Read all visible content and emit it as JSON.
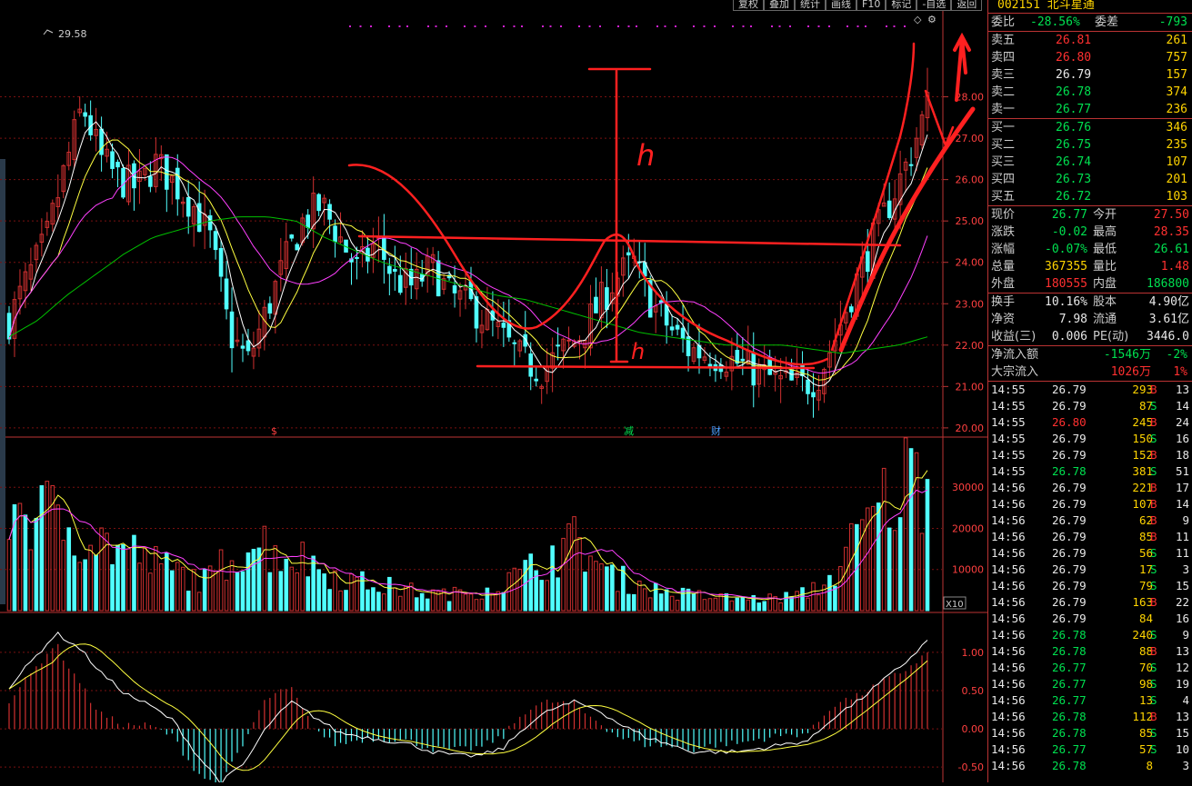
{
  "stock": {
    "code": "002151",
    "name": "北斗星通"
  },
  "toolbar": [
    "复权",
    "叠加",
    "统计",
    "画线",
    "F10",
    "标记",
    "-自选",
    "返回"
  ],
  "colors": {
    "up": "#ff3030",
    "down": "#00e050",
    "flat": "#e8e8e8",
    "vol": "#ffd400",
    "upBar": "#d03030",
    "downBar": "#50ffff",
    "ma5": "#ffffff",
    "ma10": "#ffff40",
    "ma20": "#ff40ff",
    "ma60": "#00c000",
    "annot": "#ff2020",
    "grid": "#7a1010"
  },
  "price_axis_labels": [
    "28.00",
    "27.00",
    "26.00",
    "25.00",
    "24.00",
    "23.00",
    "22.00",
    "21.00",
    "20.00"
  ],
  "vol_axis_labels": [
    "30000",
    "20000",
    "10000"
  ],
  "vol_unit": "X10",
  "macd_axis_labels": [
    "1.00",
    "0.50",
    "0.00",
    "-0.50"
  ],
  "max_label": "29.58",
  "event_marks": [
    "$",
    "减",
    "财"
  ],
  "annotations": {
    "h1": "h",
    "h2": "h"
  },
  "quote": {
    "weibi": {
      "label": "委比",
      "value": "-28.56%",
      "c": "grn"
    },
    "weicha": {
      "label": "委差",
      "value": "-793",
      "c": "grn"
    },
    "asks": [
      {
        "label": "卖五",
        "price": "26.81",
        "vol": "261",
        "c": "red"
      },
      {
        "label": "卖四",
        "price": "26.80",
        "vol": "757",
        "c": "red"
      },
      {
        "label": "卖三",
        "price": "26.79",
        "vol": "157",
        "c": "wht"
      },
      {
        "label": "卖二",
        "price": "26.78",
        "vol": "374",
        "c": "grn"
      },
      {
        "label": "卖一",
        "price": "26.77",
        "vol": "236",
        "c": "grn"
      }
    ],
    "bids": [
      {
        "label": "买一",
        "price": "26.76",
        "vol": "346",
        "c": "grn"
      },
      {
        "label": "买二",
        "price": "26.75",
        "vol": "235",
        "c": "grn"
      },
      {
        "label": "买三",
        "price": "26.74",
        "vol": "107",
        "c": "grn"
      },
      {
        "label": "买四",
        "price": "26.73",
        "vol": "201",
        "c": "grn"
      },
      {
        "label": "买五",
        "price": "26.72",
        "vol": "103",
        "c": "grn"
      }
    ],
    "stats": [
      [
        {
          "label": "现价",
          "value": "26.77",
          "c": "grn"
        },
        {
          "label": "今开",
          "value": "27.50",
          "c": "red"
        }
      ],
      [
        {
          "label": "涨跌",
          "value": "-0.02",
          "c": "grn"
        },
        {
          "label": "最高",
          "value": "28.35",
          "c": "red"
        }
      ],
      [
        {
          "label": "涨幅",
          "value": "-0.07%",
          "c": "grn"
        },
        {
          "label": "最低",
          "value": "26.61",
          "c": "grn"
        }
      ],
      [
        {
          "label": "总量",
          "value": "367355",
          "c": "yel"
        },
        {
          "label": "量比",
          "value": "1.48",
          "c": "red"
        }
      ],
      [
        {
          "label": "外盘",
          "value": "180555",
          "c": "red"
        },
        {
          "label": "内盘",
          "value": "186800",
          "c": "grn"
        }
      ]
    ],
    "fund": [
      [
        {
          "label": "换手",
          "value": "10.16%",
          "c": "wht"
        },
        {
          "label": "股本",
          "value": "4.90亿",
          "c": "wht"
        }
      ],
      [
        {
          "label": "净资",
          "value": "7.98",
          "c": "wht"
        },
        {
          "label": "流通",
          "value": "3.61亿",
          "c": "wht"
        }
      ],
      [
        {
          "label": "收益(三)",
          "value": "0.006",
          "c": "wht"
        },
        {
          "label": "PE(动)",
          "value": "3446.0",
          "c": "wht"
        }
      ]
    ],
    "flows": [
      {
        "label": "净流入额",
        "value": "-1546万",
        "pct": "-2%",
        "c": "grn"
      },
      {
        "label": "大宗流入",
        "value": "1026万",
        "pct": "1%",
        "c": "red"
      }
    ]
  },
  "ticks": [
    {
      "t": "14:55",
      "p": "26.79",
      "pc": "wht",
      "v": "293",
      "s": "B",
      "n": "13"
    },
    {
      "t": "14:55",
      "p": "26.79",
      "pc": "wht",
      "v": "87",
      "s": "S",
      "n": "14"
    },
    {
      "t": "14:55",
      "p": "26.80",
      "pc": "red",
      "v": "245",
      "s": "B",
      "n": "24"
    },
    {
      "t": "14:55",
      "p": "26.79",
      "pc": "wht",
      "v": "150",
      "s": "S",
      "n": "16"
    },
    {
      "t": "14:55",
      "p": "26.79",
      "pc": "wht",
      "v": "152",
      "s": "B",
      "n": "18"
    },
    {
      "t": "14:55",
      "p": "26.78",
      "pc": "grn",
      "v": "381",
      "s": "S",
      "n": "51"
    },
    {
      "t": "14:56",
      "p": "26.79",
      "pc": "wht",
      "v": "221",
      "s": "B",
      "n": "17"
    },
    {
      "t": "14:56",
      "p": "26.79",
      "pc": "wht",
      "v": "107",
      "s": "B",
      "n": "14"
    },
    {
      "t": "14:56",
      "p": "26.79",
      "pc": "wht",
      "v": "62",
      "s": "B",
      "n": "9"
    },
    {
      "t": "14:56",
      "p": "26.79",
      "pc": "wht",
      "v": "85",
      "s": "B",
      "n": "11"
    },
    {
      "t": "14:56",
      "p": "26.79",
      "pc": "wht",
      "v": "56",
      "s": "S",
      "n": "11"
    },
    {
      "t": "14:56",
      "p": "26.79",
      "pc": "wht",
      "v": "17",
      "s": "S",
      "n": "3"
    },
    {
      "t": "14:56",
      "p": "26.79",
      "pc": "wht",
      "v": "79",
      "s": "S",
      "n": "15"
    },
    {
      "t": "14:56",
      "p": "26.79",
      "pc": "wht",
      "v": "163",
      "s": "B",
      "n": "22"
    },
    {
      "t": "14:56",
      "p": "26.79",
      "pc": "wht",
      "v": "84",
      "s": "",
      "n": "16"
    },
    {
      "t": "14:56",
      "p": "26.78",
      "pc": "grn",
      "v": "240",
      "s": "S",
      "n": "9"
    },
    {
      "t": "14:56",
      "p": "26.78",
      "pc": "grn",
      "v": "88",
      "s": "B",
      "n": "13"
    },
    {
      "t": "14:56",
      "p": "26.77",
      "pc": "grn",
      "v": "70",
      "s": "S",
      "n": "12"
    },
    {
      "t": "14:56",
      "p": "26.77",
      "pc": "grn",
      "v": "98",
      "s": "S",
      "n": "19"
    },
    {
      "t": "14:56",
      "p": "26.77",
      "pc": "grn",
      "v": "13",
      "s": "S",
      "n": "4"
    },
    {
      "t": "14:56",
      "p": "26.78",
      "pc": "grn",
      "v": "112",
      "s": "B",
      "n": "13"
    },
    {
      "t": "14:56",
      "p": "26.78",
      "pc": "grn",
      "v": "85",
      "s": "S",
      "n": "15"
    },
    {
      "t": "14:56",
      "p": "26.77",
      "pc": "grn",
      "v": "57",
      "s": "S",
      "n": "10"
    },
    {
      "t": "14:56",
      "p": "26.78",
      "pc": "grn",
      "v": "8",
      "s": "",
      "n": "3"
    }
  ],
  "chart_data": {
    "type": "candlestick",
    "price_ylim": [
      19.8,
      29.9
    ],
    "close_path": [
      22.6,
      23.6,
      24.5,
      26.2,
      27.8,
      26.5,
      26.0,
      25.8,
      26.4,
      25.9,
      25.4,
      24.5,
      22.3,
      21.6,
      22.8,
      24.0,
      25.0,
      25.4,
      24.6,
      23.8,
      24.5,
      23.6,
      23.4,
      23.9,
      23.2,
      23.0,
      22.6,
      22.1,
      21.6,
      21.4,
      21.8,
      22.2,
      22.9,
      23.6,
      24.0,
      23.0,
      22.4,
      21.9,
      21.8,
      21.7,
      21.5,
      21.3,
      21.1,
      21.0,
      21.2,
      22.2,
      23.4,
      24.5,
      25.5,
      26.5,
      27.8
    ],
    "ma60_path": [
      22.2,
      22.6,
      23.2,
      23.7,
      24.2,
      24.6,
      24.8,
      25.0,
      25.1,
      25.1,
      25.0,
      24.6,
      24.3,
      24.0,
      23.8,
      23.6,
      23.4,
      23.2,
      23.1,
      22.9,
      22.7,
      22.5,
      22.3,
      22.2,
      22.1,
      22.0,
      22.0,
      22.0,
      21.9,
      21.8,
      21.9,
      22.0,
      22.2
    ],
    "volume_ylim": [
      0,
      38000
    ],
    "volume_path": [
      26000,
      24000,
      22000,
      19000,
      16000,
      14000,
      11000,
      9000,
      7000,
      14000,
      17000,
      14000,
      12000,
      9000,
      7000,
      6000,
      5000,
      4000,
      4000,
      5000,
      7000,
      10000,
      14000,
      17000,
      9000,
      7000,
      5000,
      4000,
      3500,
      3000,
      2800,
      3000,
      4000,
      7000,
      16000,
      24000,
      31000,
      35000
    ],
    "macd_ylim": [
      -0.7,
      1.45
    ],
    "macd_dif_path": [
      0.55,
      0.9,
      1.25,
      1.05,
      0.7,
      0.45,
      0.3,
      0.1,
      -0.35,
      -0.7,
      -0.45,
      0.05,
      0.35,
      0.15,
      -0.05,
      -0.1,
      -0.15,
      -0.2,
      -0.3,
      -0.35,
      -0.35,
      -0.25,
      0.05,
      0.25,
      0.35,
      0.25,
      0.05,
      -0.1,
      -0.2,
      -0.3,
      -0.3,
      -0.3,
      -0.25,
      -0.2,
      -0.15,
      0.15,
      0.35,
      0.6,
      0.85,
      1.15
    ]
  }
}
